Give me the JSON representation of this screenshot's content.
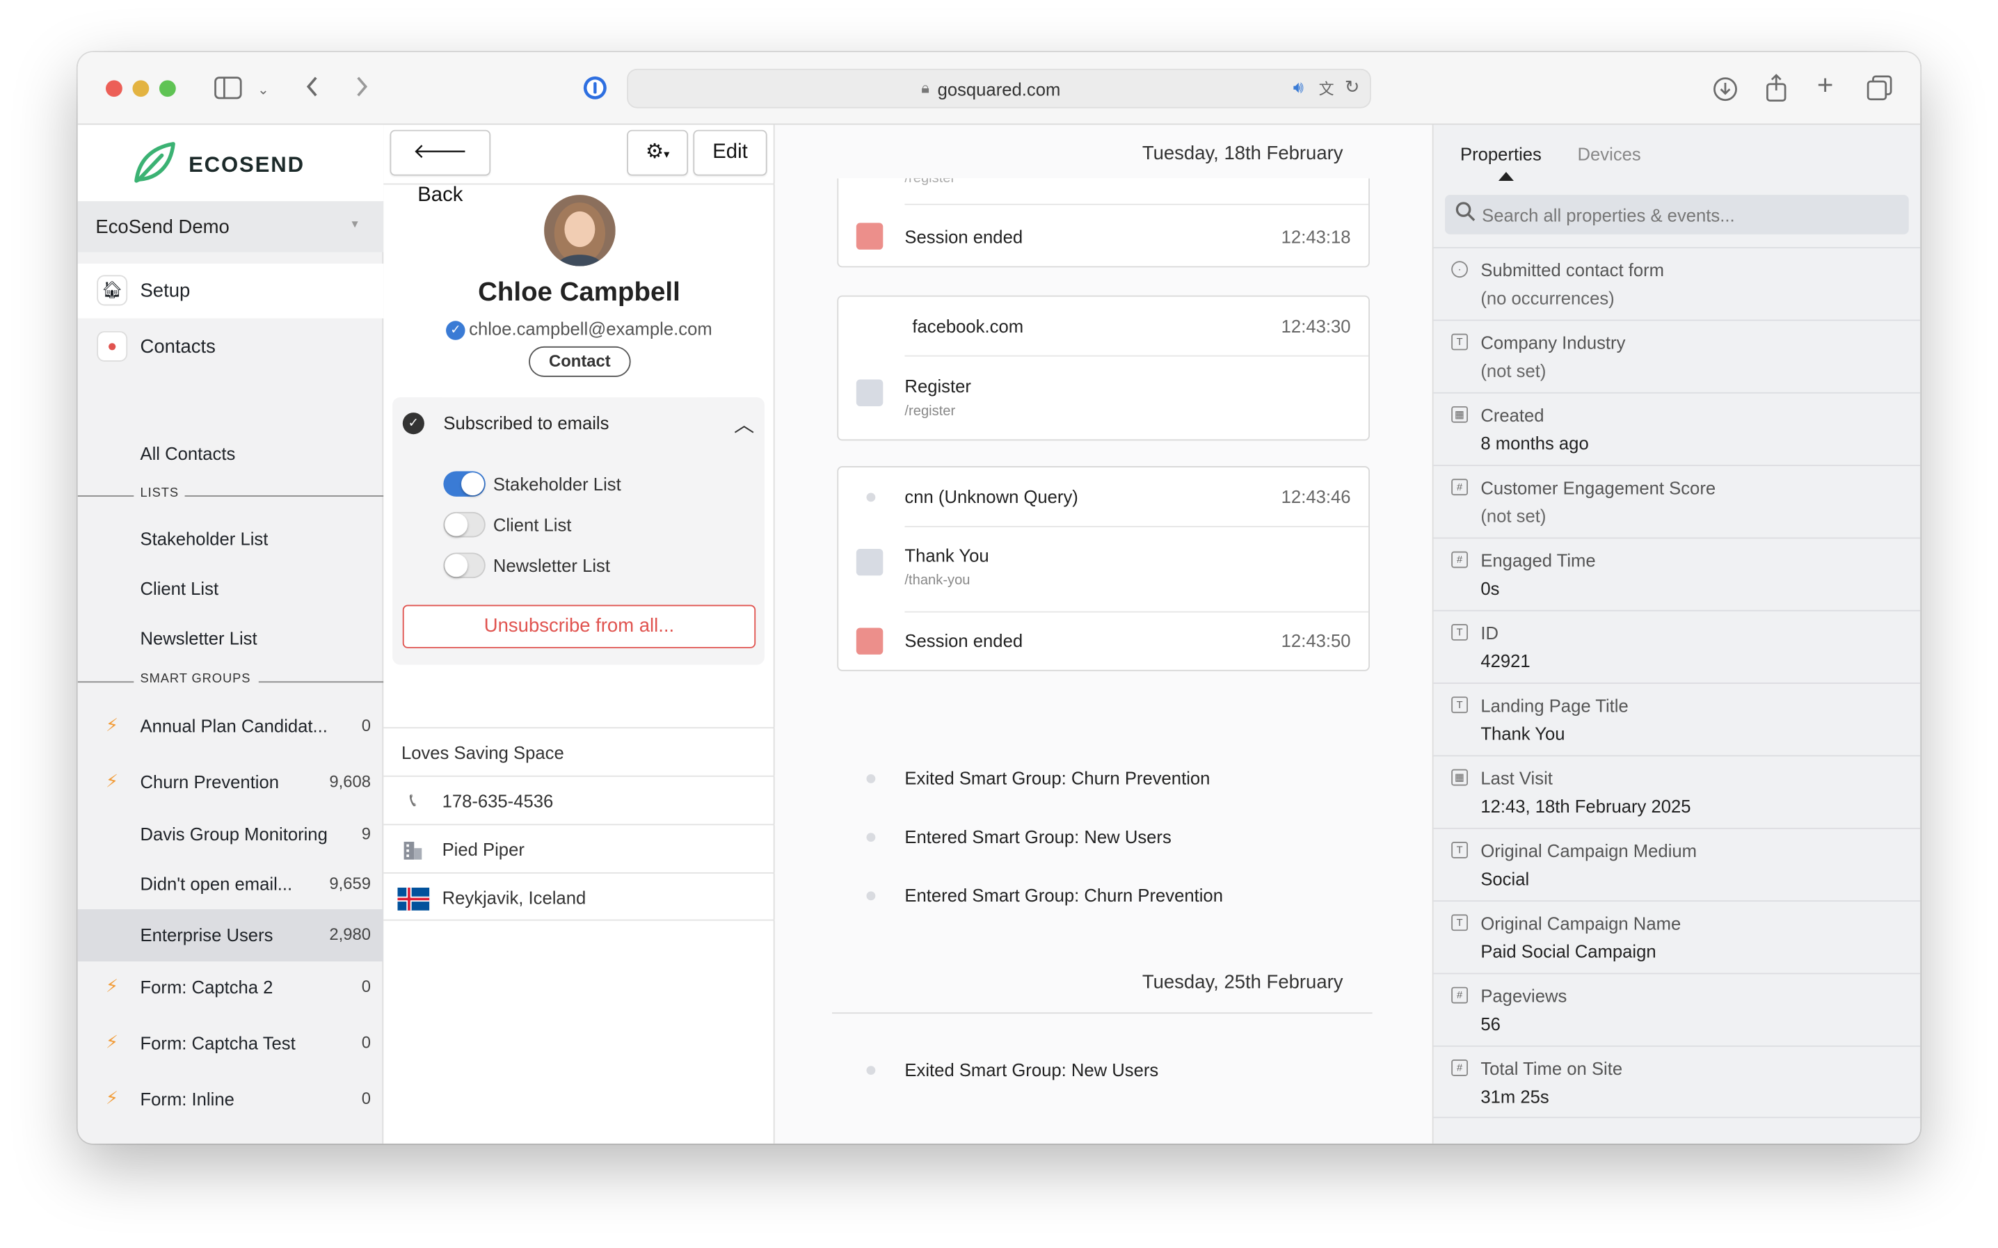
{
  "browser": {
    "url": "gosquared.com"
  },
  "sidebar": {
    "brand": "ECOSEND",
    "account": "EcoSend Demo",
    "nav": [
      {
        "label": "Setup"
      },
      {
        "label": "Contacts"
      }
    ],
    "all_contacts": "All Contacts",
    "lists_heading": "LISTS",
    "lists": [
      "Stakeholder List",
      "Client List",
      "Newsletter List"
    ],
    "smart_groups_heading": "SMART GROUPS",
    "smart_groups": [
      {
        "name": "Annual Plan Candidat...",
        "count": "0",
        "bolt": true
      },
      {
        "name": "Churn Prevention",
        "count": "9,608",
        "bolt": true
      },
      {
        "name": "Davis Group Monitoring",
        "count": "9",
        "bolt": false
      },
      {
        "name": "Didn't open email...",
        "count": "9,659",
        "bolt": false
      },
      {
        "name": "Enterprise Users",
        "count": "2,980",
        "bolt": false,
        "active": true
      },
      {
        "name": "Form: Captcha 2",
        "count": "0",
        "bolt": true
      },
      {
        "name": "Form: Captcha Test",
        "count": "0",
        "bolt": true
      },
      {
        "name": "Form: Inline",
        "count": "0",
        "bolt": true
      }
    ]
  },
  "contact": {
    "back_label": "Back",
    "edit_label": "Edit",
    "name": "Chloe Campbell",
    "email": "chloe.campbell@example.com",
    "type": "Contact",
    "subscription_header": "Subscribed to emails",
    "lists": [
      {
        "label": "Stakeholder List",
        "on": true
      },
      {
        "label": "Client List",
        "on": false
      },
      {
        "label": "Newsletter List",
        "on": false
      }
    ],
    "unsubscribe_label": "Unsubscribe from all...",
    "tag": "Loves Saving Space",
    "phone": "178-635-4536",
    "company": "Pied Piper",
    "location": "Reykjavik, Iceland"
  },
  "timeline": {
    "day1": "Tuesday, 18th February",
    "card1": [
      {
        "title": "Session ended",
        "time": "12:43:18",
        "color": "#ec8f8b"
      }
    ],
    "card2_source": {
      "title": "facebook.com",
      "time": "12:43:30"
    },
    "card2_page": {
      "title": "Register",
      "path": "/register"
    },
    "card3_source": {
      "title": "cnn (Unknown Query)",
      "time": "12:43:46"
    },
    "card3_page": {
      "title": "Thank You",
      "path": "/thank-you"
    },
    "card3_end": {
      "title": "Session ended",
      "time": "12:43:50"
    },
    "events": [
      "Exited Smart Group: Churn Prevention",
      "Entered Smart Group: New Users",
      "Entered Smart Group: Churn Prevention"
    ],
    "day2": "Tuesday, 25th February",
    "events2": [
      "Exited Smart Group: New Users"
    ]
  },
  "properties": {
    "tabs": [
      "Properties",
      "Devices"
    ],
    "search_placeholder": "Search all properties & events...",
    "items": [
      {
        "name": "Submitted contact form",
        "value": "(no occurrences)",
        "dim": true,
        "icon": "target-icon"
      },
      {
        "name": "Company Industry",
        "value": "(not set)",
        "dim": true,
        "icon": "text-type-icon"
      },
      {
        "name": "Created",
        "value": "8 months ago",
        "dim": false,
        "icon": "calendar-icon"
      },
      {
        "name": "Customer Engagement Score",
        "value": "(not set)",
        "dim": true,
        "icon": "number-type-icon"
      },
      {
        "name": "Engaged Time",
        "value": "0s",
        "dim": false,
        "icon": "number-type-icon"
      },
      {
        "name": "ID",
        "value": "42921",
        "dim": false,
        "icon": "text-type-icon"
      },
      {
        "name": "Landing Page Title",
        "value": "Thank You",
        "dim": false,
        "icon": "text-type-icon"
      },
      {
        "name": "Last Visit",
        "value": "12:43, 18th February 2025",
        "dim": false,
        "icon": "calendar-icon"
      },
      {
        "name": "Original Campaign Medium",
        "value": "Social",
        "dim": false,
        "icon": "text-type-icon"
      },
      {
        "name": "Original Campaign Name",
        "value": "Paid Social Campaign",
        "dim": false,
        "icon": "text-type-icon"
      },
      {
        "name": "Pageviews",
        "value": "56",
        "dim": false,
        "icon": "number-type-icon"
      },
      {
        "name": "Total Time on Site",
        "value": "31m 25s",
        "dim": false,
        "icon": "number-type-icon"
      }
    ]
  },
  "colors": {
    "accent": "#3a7bd5",
    "danger": "#e0534f",
    "bolt": "#f29c38",
    "session_end": "#ec8f8b",
    "pageview": "#d7dbe3"
  }
}
